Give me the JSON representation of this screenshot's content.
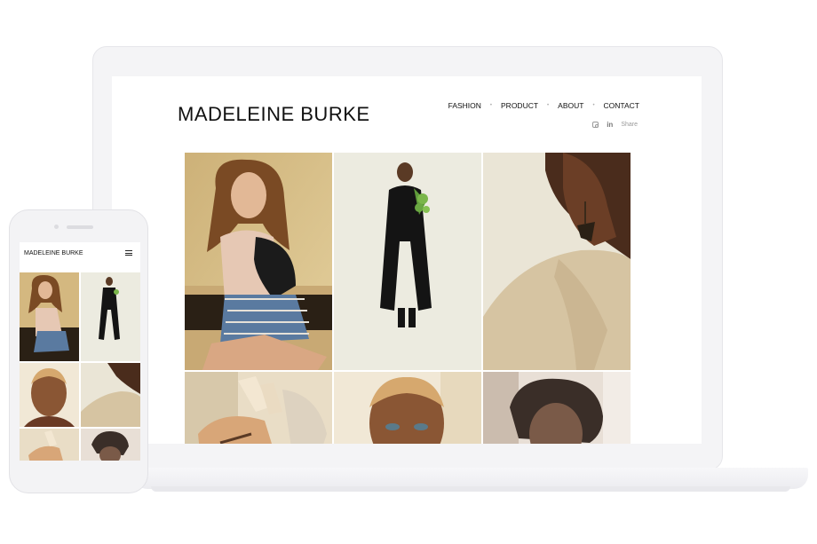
{
  "site": {
    "title": "MADELEINE BURKE",
    "nav": [
      "FASHION",
      "PRODUCT",
      "ABOUT",
      "CONTACT"
    ],
    "social": {
      "instagram_icon": "instagram-icon",
      "linkedin_label": "in",
      "share_label": "Share"
    }
  },
  "mobile": {
    "title": "MADELEINE BURKE",
    "menu_icon": "hamburger-menu-icon"
  },
  "colors": {
    "tile1_bg": "#d9c08a",
    "tile2_bg": "#ecebe0",
    "tile3_bg": "#eae5d6",
    "tile4_bg": "#e8dcc5",
    "tile5_bg": "#f0e6d2",
    "tile6_bg": "#d5c7b8"
  }
}
